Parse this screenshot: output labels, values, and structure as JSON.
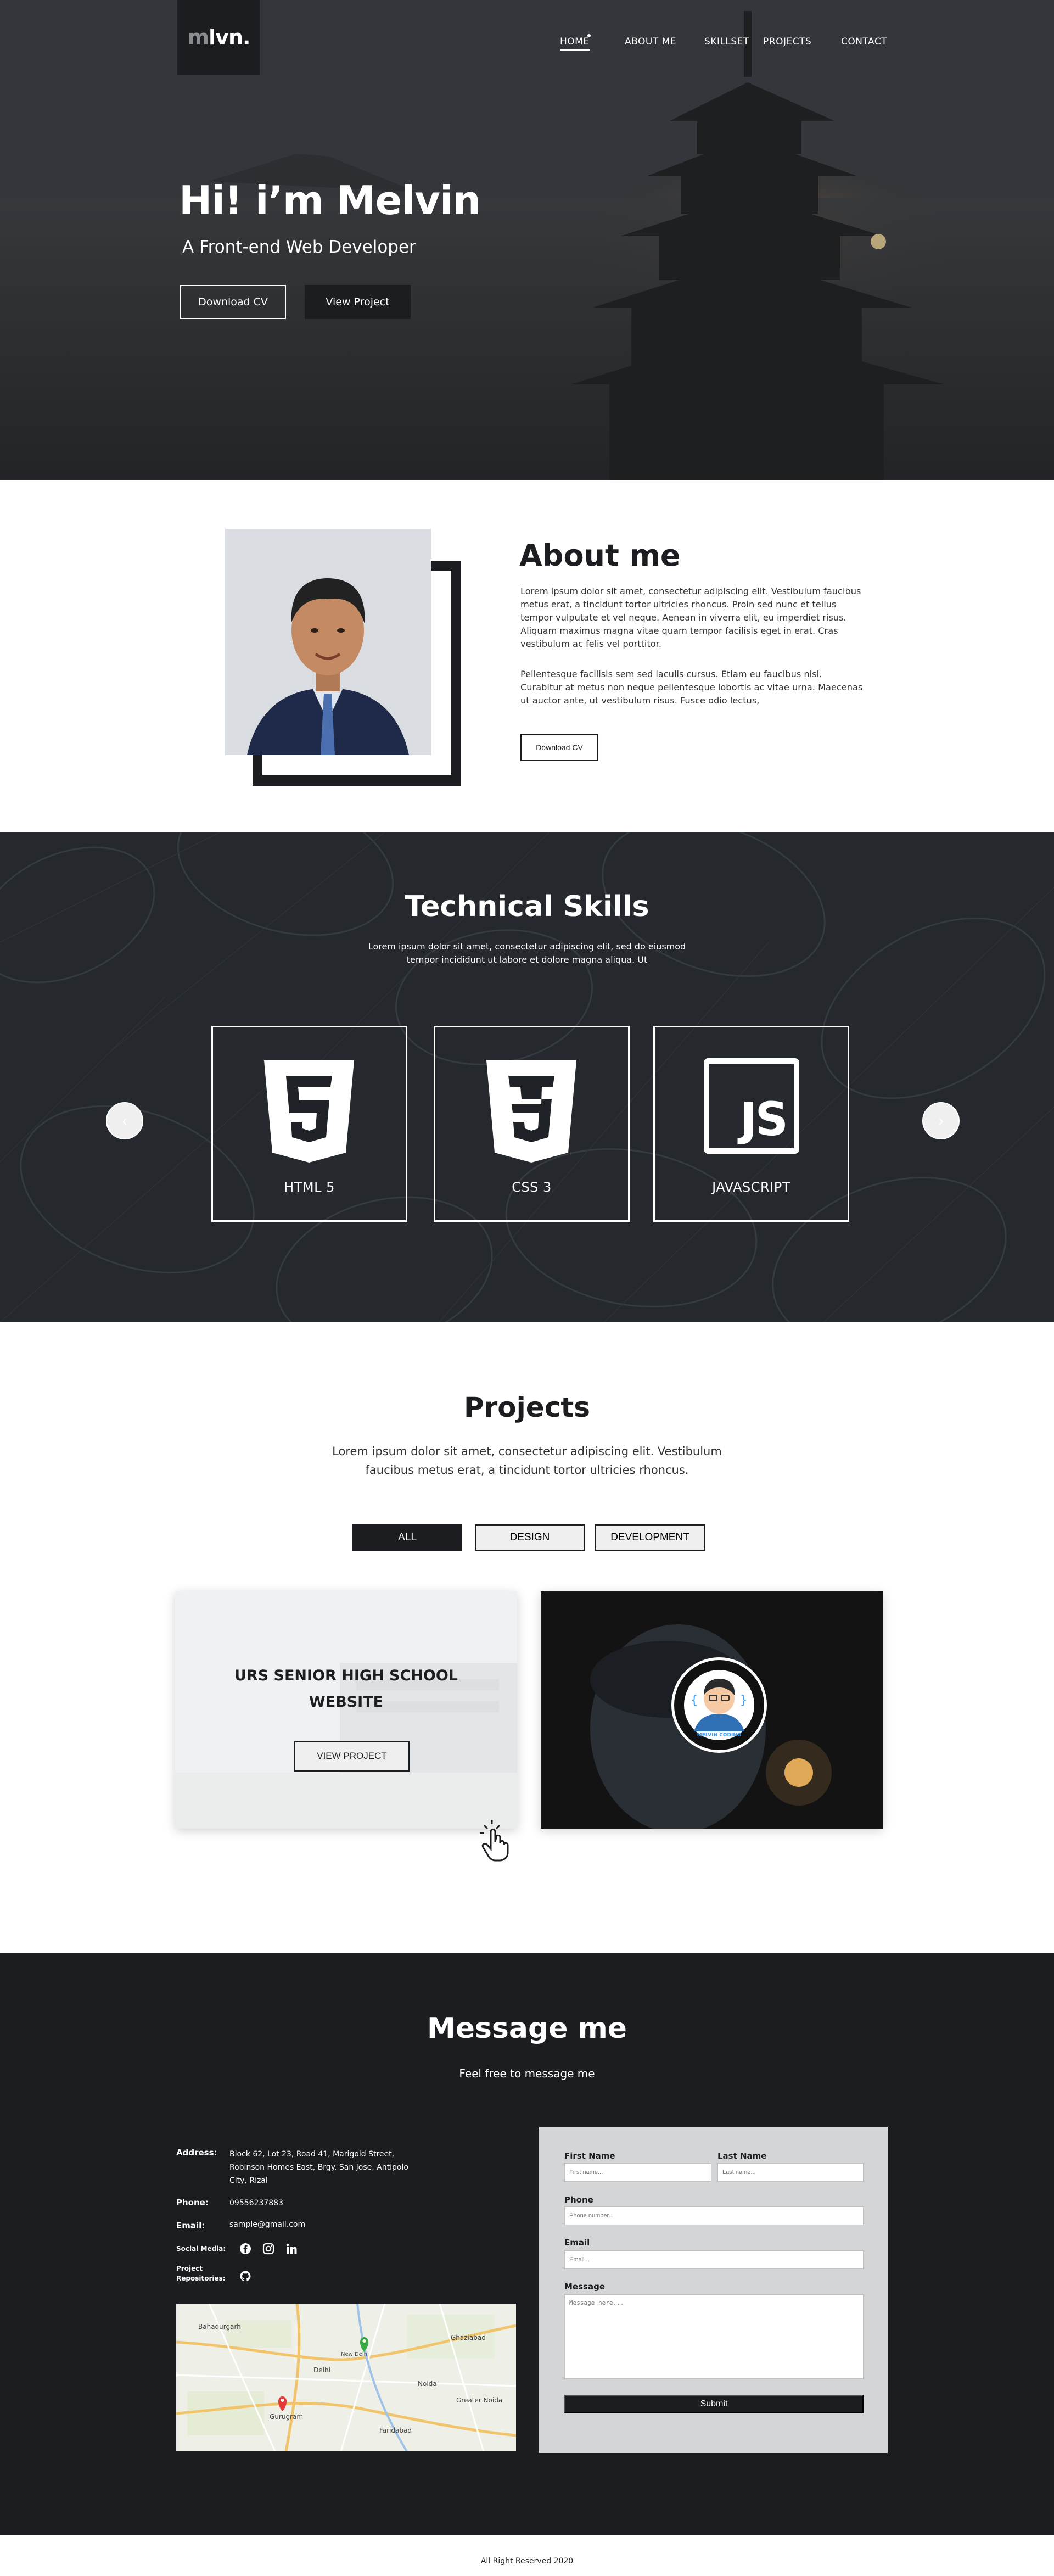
{
  "logo": {
    "main": "m",
    "rest": "lvn."
  },
  "nav": {
    "items": [
      "HOME",
      "ABOUT  ME",
      "SKILLSET",
      "PROJECTS",
      "CONTACT"
    ]
  },
  "hero": {
    "title": "Hi! i’m Melvin",
    "subtitle": "A Front-end Web Developer",
    "download_cv": "Download CV",
    "view_project": "View Project"
  },
  "about": {
    "title": "About me",
    "para1": "Lorem ipsum dolor sit amet, consectetur adipiscing elit. Vestibulum faucibus metus erat, a tincidunt tortor ultricies rhoncus. Proin sed nunc et tellus tempor vulputate et vel neque. Aenean in viverra elit, eu imperdiet risus. Aliquam maximus magna vitae quam tempor facilisis eget in erat. Cras vestibulum ac felis vel porttitor.",
    "para2": "Pellentesque facilisis sem sed iaculis cursus. Etiam eu faucibus nisl. Curabitur at metus non neque pellentesque lobortis ac vitae urna. Maecenas ut auctor ante, ut vestibulum risus. Fusce odio lectus,",
    "download_cv": "Download CV"
  },
  "skills": {
    "title": "Technical Skills",
    "desc": "Lorem ipsum dolor sit amet, consectetur adipiscing elit, sed do eiusmod tempor incididunt ut labore et dolore magna aliqua. Ut",
    "items": [
      {
        "label": "HTML 5",
        "icon": "html5-icon"
      },
      {
        "label": "CSS 3",
        "icon": "css3-icon"
      },
      {
        "label": "JAVASCRIPT",
        "icon": "javascript-icon"
      }
    ]
  },
  "projects": {
    "title": "Projects",
    "desc": "Lorem ipsum dolor sit amet, consectetur adipiscing elit. Vestibulum faucibus metus erat, a tincidunt tortor ultricies rhoncus.",
    "filters": [
      "ALL",
      "DESIGN",
      "DEVELOPMENT"
    ],
    "card1_title_line1": "URS SENIOR HIGH SCHOOL",
    "card1_title_line2": "WEBSITE",
    "card1_button": "VIEW PROJECT",
    "card2_badge": "MELVIN CODING"
  },
  "message": {
    "title": "Message me",
    "subtitle": "Feel free to message me",
    "address_label": "Address:",
    "address": "Block 62, Lot 23, Road 41, Marigold Street, Robinson Homes East, Brgy. San Jose, Antipolo City, Rizal",
    "phone_label": "Phone:",
    "phone": "09556237883",
    "email_label": "Email:",
    "email": "sample@gmail.com",
    "social_label": "Social Media:",
    "repo_label1": "Project",
    "repo_label2": "Repositories:",
    "map_labels": [
      "Bahadurgarh",
      "Ghaziabad",
      "Delhi",
      "Noida",
      "Greater Noida",
      "Gurugram",
      "Faridabad",
      "New Delhi"
    ]
  },
  "form": {
    "first_name_label": "First Name",
    "first_name_ph": "First name...",
    "last_name_label": "Last Name",
    "last_name_ph": "Last name...",
    "phone_label": "Phone",
    "phone_ph": "Phone number...",
    "email_label": "Email",
    "email_ph": "Email...",
    "message_label": "Message",
    "message_ph": "Message here...",
    "submit": "Submit"
  },
  "footer": {
    "text": "All Right Reserved 2020"
  },
  "colors": {
    "dark": "#1b1d21",
    "form_bg": "#d4d5d6",
    "map_pin_green": "#3aa845",
    "map_pin_red": "#e53935"
  }
}
